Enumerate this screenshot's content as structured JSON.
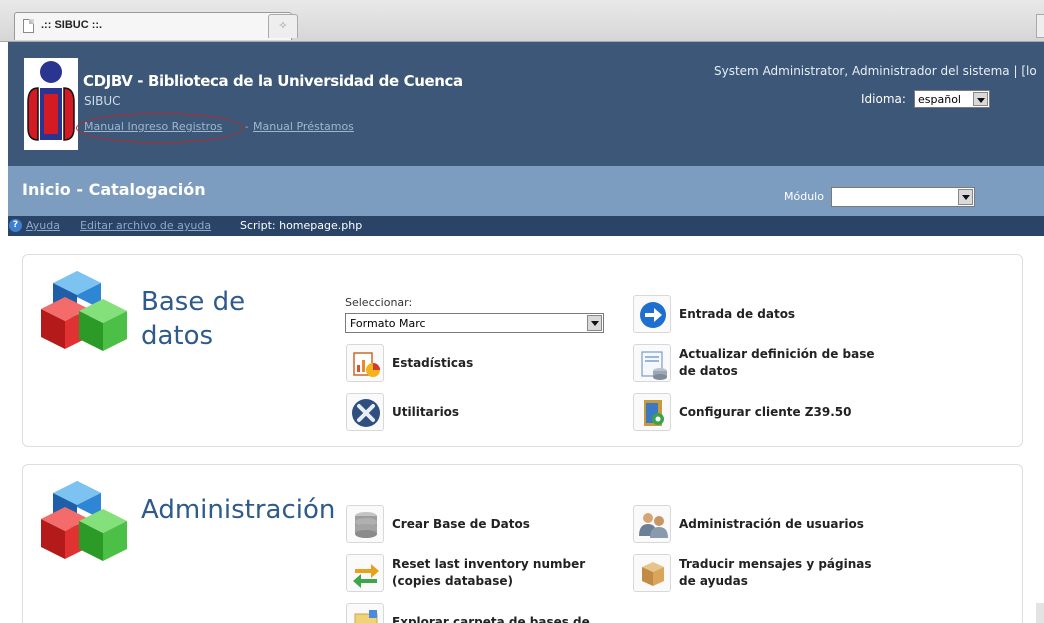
{
  "browser": {
    "tab_title": ".:: SIBUC ::.",
    "new_tab_glyph": "✧"
  },
  "header": {
    "brand": "CDJBV - Biblioteca de la Universidad de Cuenca",
    "subtitle": "SIBUC",
    "manual_registros": "Manual Ingreso Registros",
    "separator": "-",
    "manual_prestamos": "Manual Préstamos",
    "user": "System Administrator, Administrador del sistema | [lo",
    "language_label": "Idioma:",
    "language_value": "español"
  },
  "titlebar": {
    "title": "Inicio - Catalogación",
    "module_label": "Módulo",
    "module_value": ""
  },
  "helpbar": {
    "help_icon": "?",
    "help": "Ayuda",
    "edit_help": "Editar archivo de ayuda",
    "script": "Script: homepage.php"
  },
  "database": {
    "title_line1": "Base de",
    "title_line2": "datos",
    "select_label": "Seleccionar:",
    "select_value": "Formato Marc",
    "items": [
      {
        "label": "Entrada de datos",
        "icon": "arrow-right-icon"
      },
      {
        "label": "Estadísticas",
        "icon": "statistics-icon"
      },
      {
        "label": "Actualizar definición de base de datos",
        "icon": "update-database-definition-icon"
      },
      {
        "label": "Utilitarios",
        "icon": "utilities-icon"
      },
      {
        "label": "Configurar cliente Z39.50",
        "icon": "z3950-client-icon"
      }
    ]
  },
  "administration": {
    "title": "Administración",
    "items": [
      {
        "label": "Crear Base de Datos",
        "icon": "database-stack-icon"
      },
      {
        "label": "Administración de usuarios",
        "icon": "users-icon"
      },
      {
        "label": "Reset last inventory number (copies database)",
        "icon": "reset-icon"
      },
      {
        "label": "Traducir mensajes y páginas de ayudas",
        "icon": "translate-box-icon"
      },
      {
        "label": "Explorar carpeta de bases de",
        "icon": "explore-folder-icon"
      }
    ]
  },
  "colors": {
    "header_bg": "#3c5777",
    "titlebar_bg": "#7d9dc0",
    "helpbar_bg": "#294467",
    "section_title": "#2e5a8c",
    "annotation_oval": "#b52b2b"
  }
}
